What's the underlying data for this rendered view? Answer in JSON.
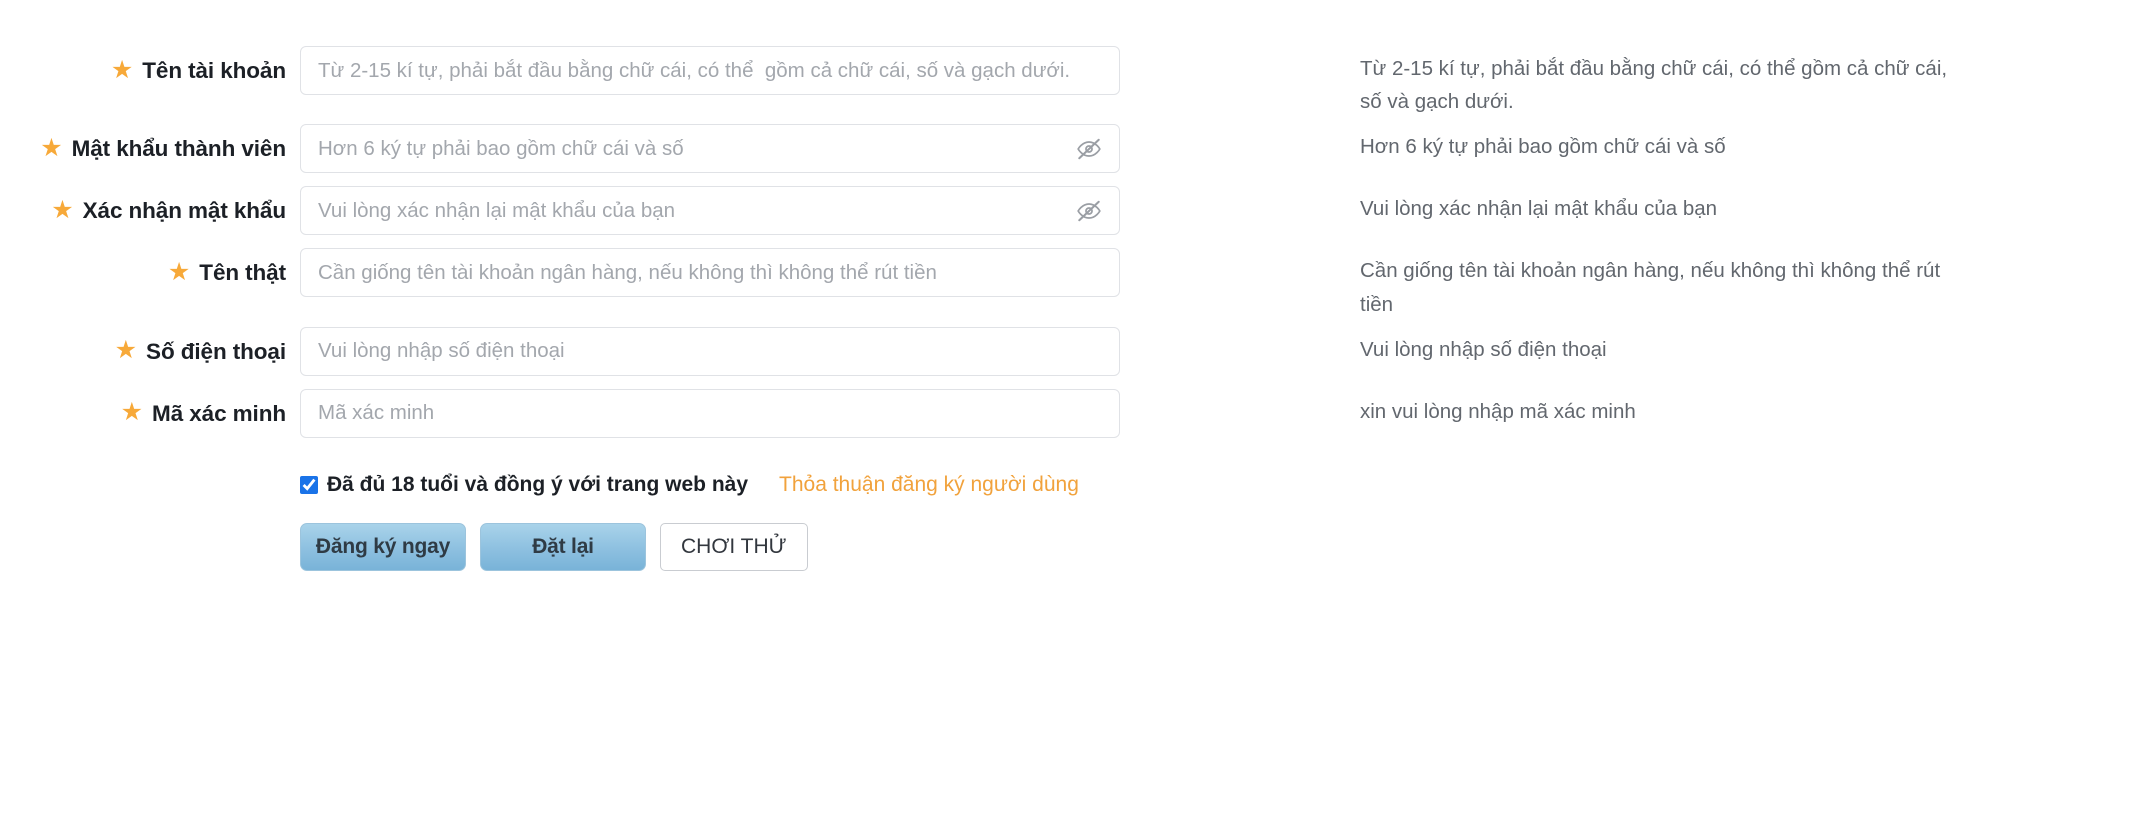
{
  "form": {
    "rows": [
      {
        "label": "Tên tài khoản",
        "required": true,
        "star": "★",
        "placeholder": "Từ 2-15 kí tự, phải bắt đầu bằng chữ cái, có thể  gồm cả chữ cái, số và gạch dưới.",
        "value": "",
        "helper": "Từ 2-15 kí tự, phải bắt đầu bằng chữ cái, có thể gồm cả chữ cái, số và gạch dưới.",
        "type": "text",
        "has_eye_toggle": false
      },
      {
        "label": "Mật khẩu thành viên",
        "required": true,
        "star": "★",
        "placeholder": "Hơn 6 ký tự phải bao gồm chữ cái và số",
        "value": "",
        "helper": "Hơn 6 ký tự phải bao gồm chữ cái và số",
        "type": "password",
        "has_eye_toggle": true
      },
      {
        "label": "Xác nhận mật khẩu",
        "required": true,
        "star": "★",
        "placeholder": "Vui lòng xác nhận lại mật khẩu của bạn",
        "value": "",
        "helper": "Vui lòng xác nhận lại mật khẩu của bạn",
        "type": "password",
        "has_eye_toggle": true
      },
      {
        "label": "Tên thật",
        "required": true,
        "star": "★",
        "placeholder": "Cần giống tên tài khoản ngân hàng, nếu không thì không thể rút tiền",
        "value": "",
        "helper": "Cần giống tên tài khoản ngân hàng, nếu không thì không thể rút tiền",
        "type": "text",
        "has_eye_toggle": false
      },
      {
        "label": "Số điện thoại",
        "required": true,
        "star": "★",
        "placeholder": "Vui lòng nhập số điện thoại",
        "value": "",
        "helper": "Vui lòng nhập số điện thoại",
        "type": "text",
        "has_eye_toggle": false
      },
      {
        "label": "Mã xác minh",
        "required": true,
        "star": "★",
        "placeholder": "Mã xác minh",
        "value": "",
        "helper": "xin vui lòng nhập mã xác minh",
        "type": "text",
        "has_eye_toggle": false
      }
    ],
    "agreement": {
      "checked": true,
      "label": "Đã đủ 18 tuổi và đồng ý với trang web này",
      "link_text": "Thỏa thuận đăng ký người dùng"
    },
    "buttons": {
      "submit": "Đăng ký ngay",
      "reset": "Đặt lại",
      "trial": "CHƠI THỬ"
    }
  },
  "icons": {
    "eye_off": "eye-off-icon",
    "star": "star-icon"
  },
  "colors": {
    "star": "#f7a939",
    "link": "#f1a23c",
    "button_blue": "#8dc0e0",
    "checkbox": "#1a73e8",
    "placeholder": "#a3a7ad",
    "helper_text": "#62676e",
    "label_text": "#1c2026"
  }
}
